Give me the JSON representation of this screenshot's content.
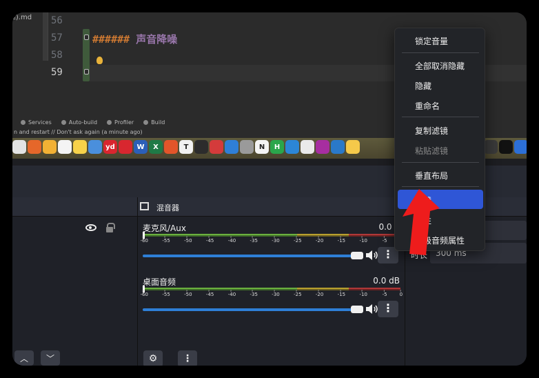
{
  "editor": {
    "file_tab": "ᴇ).md",
    "line_numbers": [
      "56",
      "57",
      "58",
      "59"
    ],
    "heading_hashes": "######",
    "heading_text": "声音降噪"
  },
  "status_bar": {
    "tabs": [
      "Services",
      "Auto-build",
      "Profiler",
      "Build"
    ],
    "notice": "n and restart // Don't ask again (a minute ago)"
  },
  "dock": {
    "icons": [
      {
        "name": "chrome-icon",
        "color": "#e3e3e3",
        "text": ""
      },
      {
        "name": "firefox-icon",
        "color": "#e5672a",
        "text": ""
      },
      {
        "name": "photos-icon",
        "color": "#f2b134",
        "text": ""
      },
      {
        "name": "reminders-icon",
        "color": "#f4f4f4",
        "text": ""
      },
      {
        "name": "notes-icon",
        "color": "#f7d24a",
        "text": ""
      },
      {
        "name": "preview-icon",
        "color": "#4a8fdc",
        "text": ""
      },
      {
        "name": "youdao-icon",
        "color": "#d9262f",
        "text": "yd"
      },
      {
        "name": "netease-music-icon",
        "color": "#d8272f",
        "text": ""
      },
      {
        "name": "word-icon",
        "color": "#2b5fb8",
        "text": "W"
      },
      {
        "name": "excel-icon",
        "color": "#1f7a46",
        "text": "X"
      },
      {
        "name": "xmind-icon",
        "color": "#e2552a",
        "text": ""
      },
      {
        "name": "typora-icon",
        "color": "#f1f1f1",
        "text": "T"
      },
      {
        "name": "screen-icon",
        "color": "#2c2c2c",
        "text": ""
      },
      {
        "name": "clash-icon",
        "color": "#d43b3b",
        "text": ""
      },
      {
        "name": "docker-icon",
        "color": "#2f7fd6",
        "text": ""
      },
      {
        "name": "automator-icon",
        "color": "#9a9a9a",
        "text": ""
      },
      {
        "name": "notion-icon",
        "color": "#f4f4f4",
        "text": "N"
      },
      {
        "name": "hbuilder-icon",
        "color": "#2aa64b",
        "text": "H"
      },
      {
        "name": "kaiti-icon",
        "color": "#2c86d6",
        "text": ""
      },
      {
        "name": "wechat-icon",
        "color": "#eaeaea",
        "text": ""
      },
      {
        "name": "jetbrains-icon",
        "color": "#a72ea0",
        "text": ""
      },
      {
        "name": "vscode-icon",
        "color": "#2a79c9",
        "text": ""
      },
      {
        "name": "egg-icon",
        "color": "#f5c94a",
        "text": ""
      }
    ],
    "right_icons": [
      {
        "name": "speedometer-icon",
        "color": "#3a3a3a",
        "text": ""
      },
      {
        "name": "capcut-icon",
        "color": "#111111",
        "text": ""
      },
      {
        "name": "blue-app-icon",
        "color": "#2c6fd6",
        "text": ""
      }
    ]
  },
  "mixer": {
    "title": "混音器",
    "ticks": [
      "-60",
      "-55",
      "-50",
      "-45",
      "-40",
      "-35",
      "-30",
      "-25",
      "-20",
      "-15",
      "-10",
      "-5",
      "0"
    ],
    "channels": [
      {
        "name": "麦克风/Aux",
        "db": "0.0 d",
        "volume": 1.0
      },
      {
        "name": "桌面音频",
        "db": "0.0 dB",
        "volume": 1.0
      }
    ],
    "menu_glyph": "⋮"
  },
  "scenes": {
    "up_glyph": "︿",
    "down_glyph": "﹀"
  },
  "mixer_controls": {
    "gear_glyph": "⚙",
    "more_glyph": "⋮"
  },
  "properties": {
    "duration_label": "时长",
    "duration_value": "300 ms"
  },
  "context_menu": {
    "items": [
      {
        "label": "锁定音量",
        "disabled": false
      },
      {
        "label": "全部取消隐藏",
        "disabled": false
      },
      {
        "label": "隐藏",
        "disabled": false
      },
      {
        "label": "重命名",
        "disabled": false
      },
      {
        "label": "复制滤镜",
        "disabled": false
      },
      {
        "label": "粘贴滤镜",
        "disabled": true
      },
      {
        "label": "垂直布局",
        "disabled": false
      },
      {
        "label": "滤镜",
        "disabled": false,
        "highlighted": true
      },
      {
        "label": "属性",
        "disabled": false
      },
      {
        "label": "高级音频属性",
        "disabled": false
      }
    ]
  },
  "colors": {
    "highlight": "#2f56d6",
    "slider": "#2e7fd6",
    "arrow": "#ee1c1c"
  }
}
